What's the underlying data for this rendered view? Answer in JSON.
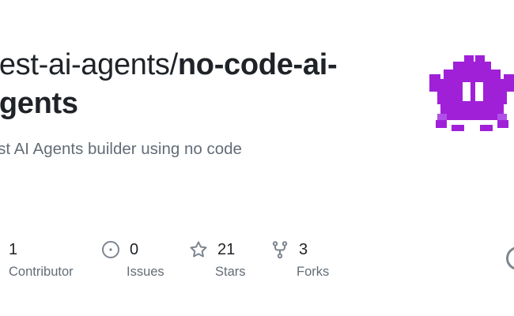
{
  "repo": {
    "owner": "best-ai-agents/",
    "name": "no-code-ai-agents",
    "description": "Best AI Agents builder using no code"
  },
  "stats": [
    {
      "value": "1",
      "label": "Contributor",
      "icon": "people-icon"
    },
    {
      "value": "0",
      "label": "Issues",
      "icon": "issue-icon"
    },
    {
      "value": "21",
      "label": "Stars",
      "icon": "star-icon"
    },
    {
      "value": "3",
      "label": "Forks",
      "icon": "fork-icon"
    }
  ],
  "colors": {
    "title": "#1f2328",
    "muted": "#636c76",
    "avatar": "#a020d8",
    "icon": "#7d8590"
  }
}
